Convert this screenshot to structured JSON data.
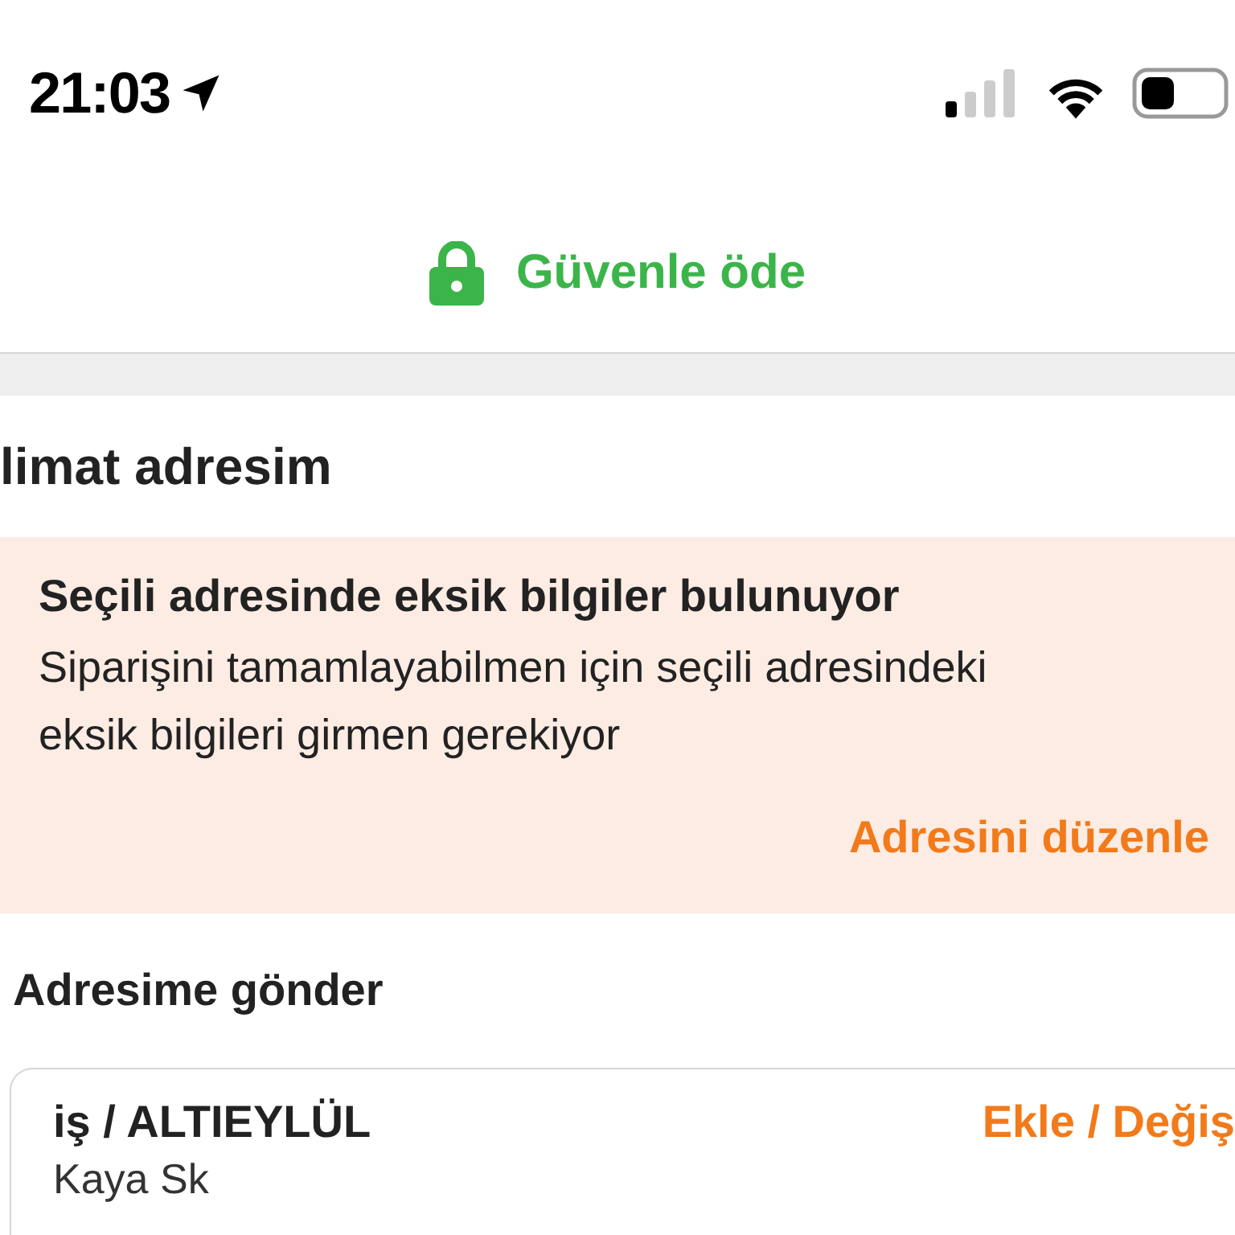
{
  "status_bar": {
    "time": "21:03"
  },
  "header": {
    "title": "Güvenle öde"
  },
  "delivery_section": {
    "title": "limat adresim"
  },
  "alert": {
    "title": "Seçili adresinde eksik bilgiler bulunuyor",
    "message": "Siparişini tamamlayabilmen için seçili adresindeki eksik bilgileri girmen gerekiyor",
    "action": "Adresini düzenle"
  },
  "ship_section": {
    "title": "Adresime gönder"
  },
  "address_card": {
    "name": "iş / ALTIEYLÜL",
    "action": "Ekle / Değiş",
    "line": "Kaya Sk"
  }
}
